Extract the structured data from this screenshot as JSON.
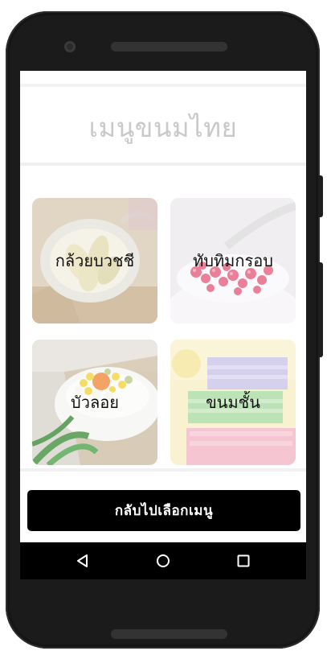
{
  "app": {
    "title": "เมนูขนมไทย"
  },
  "menu_items": [
    {
      "label": "กล้วยบวชชี",
      "image": "banana-in-coconut-milk-photo"
    },
    {
      "label": "ทับทิมกรอบ",
      "image": "red-rubies-dessert-photo"
    },
    {
      "label": "บัวลอย",
      "image": "bua-loy-dessert-photo"
    },
    {
      "label": "ขนมชั้น",
      "image": "layered-dessert-photo"
    }
  ],
  "actions": {
    "back_label": "กลับไปเลือกเมนู"
  },
  "nav": {
    "back_icon": "back-triangle-icon",
    "home_icon": "home-circle-icon",
    "recent_icon": "recent-apps-square-icon"
  },
  "colors": {
    "device_body": "#1b1b1b",
    "title_text": "#c9c9c9",
    "button_bg": "#000000",
    "button_text": "#ffffff",
    "nav_bar": "#000000"
  }
}
